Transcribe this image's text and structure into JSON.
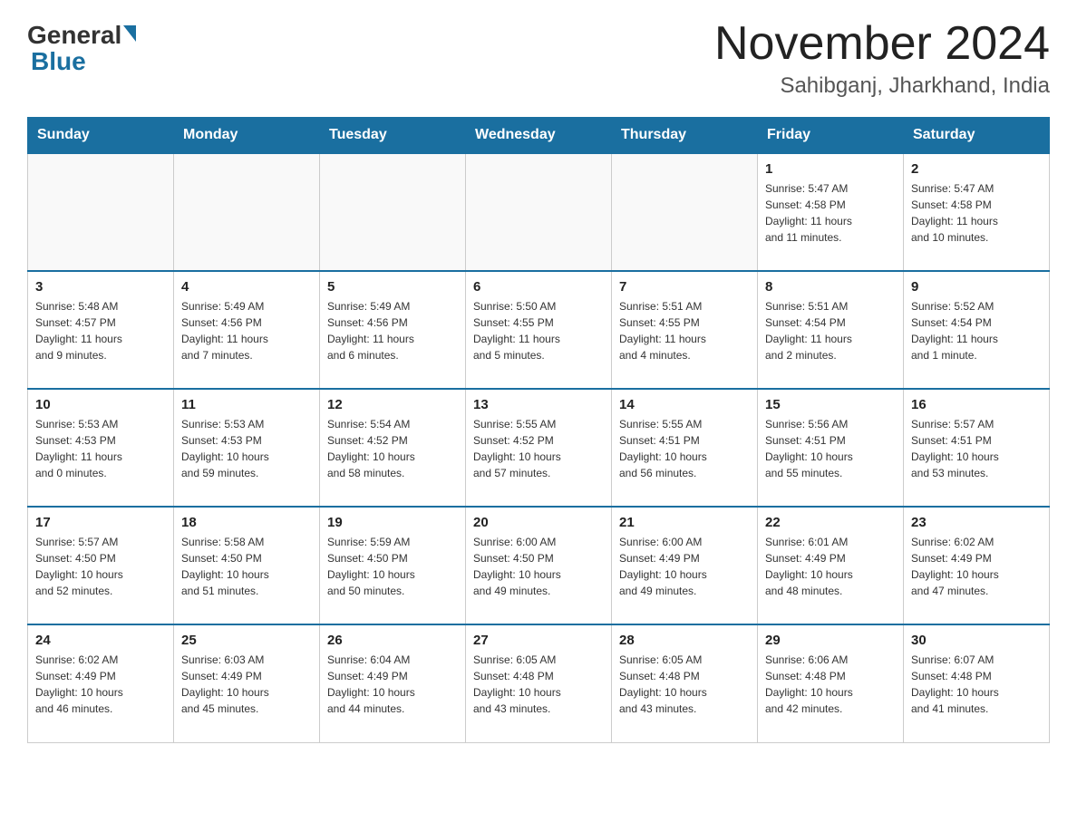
{
  "header": {
    "logo_general": "General",
    "logo_blue": "Blue",
    "month_title": "November 2024",
    "subtitle": "Sahibganj, Jharkhand, India"
  },
  "days_of_week": [
    "Sunday",
    "Monday",
    "Tuesday",
    "Wednesday",
    "Thursday",
    "Friday",
    "Saturday"
  ],
  "weeks": [
    [
      {
        "day": "",
        "info": ""
      },
      {
        "day": "",
        "info": ""
      },
      {
        "day": "",
        "info": ""
      },
      {
        "day": "",
        "info": ""
      },
      {
        "day": "",
        "info": ""
      },
      {
        "day": "1",
        "info": "Sunrise: 5:47 AM\nSunset: 4:58 PM\nDaylight: 11 hours\nand 11 minutes."
      },
      {
        "day": "2",
        "info": "Sunrise: 5:47 AM\nSunset: 4:58 PM\nDaylight: 11 hours\nand 10 minutes."
      }
    ],
    [
      {
        "day": "3",
        "info": "Sunrise: 5:48 AM\nSunset: 4:57 PM\nDaylight: 11 hours\nand 9 minutes."
      },
      {
        "day": "4",
        "info": "Sunrise: 5:49 AM\nSunset: 4:56 PM\nDaylight: 11 hours\nand 7 minutes."
      },
      {
        "day": "5",
        "info": "Sunrise: 5:49 AM\nSunset: 4:56 PM\nDaylight: 11 hours\nand 6 minutes."
      },
      {
        "day": "6",
        "info": "Sunrise: 5:50 AM\nSunset: 4:55 PM\nDaylight: 11 hours\nand 5 minutes."
      },
      {
        "day": "7",
        "info": "Sunrise: 5:51 AM\nSunset: 4:55 PM\nDaylight: 11 hours\nand 4 minutes."
      },
      {
        "day": "8",
        "info": "Sunrise: 5:51 AM\nSunset: 4:54 PM\nDaylight: 11 hours\nand 2 minutes."
      },
      {
        "day": "9",
        "info": "Sunrise: 5:52 AM\nSunset: 4:54 PM\nDaylight: 11 hours\nand 1 minute."
      }
    ],
    [
      {
        "day": "10",
        "info": "Sunrise: 5:53 AM\nSunset: 4:53 PM\nDaylight: 11 hours\nand 0 minutes."
      },
      {
        "day": "11",
        "info": "Sunrise: 5:53 AM\nSunset: 4:53 PM\nDaylight: 10 hours\nand 59 minutes."
      },
      {
        "day": "12",
        "info": "Sunrise: 5:54 AM\nSunset: 4:52 PM\nDaylight: 10 hours\nand 58 minutes."
      },
      {
        "day": "13",
        "info": "Sunrise: 5:55 AM\nSunset: 4:52 PM\nDaylight: 10 hours\nand 57 minutes."
      },
      {
        "day": "14",
        "info": "Sunrise: 5:55 AM\nSunset: 4:51 PM\nDaylight: 10 hours\nand 56 minutes."
      },
      {
        "day": "15",
        "info": "Sunrise: 5:56 AM\nSunset: 4:51 PM\nDaylight: 10 hours\nand 55 minutes."
      },
      {
        "day": "16",
        "info": "Sunrise: 5:57 AM\nSunset: 4:51 PM\nDaylight: 10 hours\nand 53 minutes."
      }
    ],
    [
      {
        "day": "17",
        "info": "Sunrise: 5:57 AM\nSunset: 4:50 PM\nDaylight: 10 hours\nand 52 minutes."
      },
      {
        "day": "18",
        "info": "Sunrise: 5:58 AM\nSunset: 4:50 PM\nDaylight: 10 hours\nand 51 minutes."
      },
      {
        "day": "19",
        "info": "Sunrise: 5:59 AM\nSunset: 4:50 PM\nDaylight: 10 hours\nand 50 minutes."
      },
      {
        "day": "20",
        "info": "Sunrise: 6:00 AM\nSunset: 4:50 PM\nDaylight: 10 hours\nand 49 minutes."
      },
      {
        "day": "21",
        "info": "Sunrise: 6:00 AM\nSunset: 4:49 PM\nDaylight: 10 hours\nand 49 minutes."
      },
      {
        "day": "22",
        "info": "Sunrise: 6:01 AM\nSunset: 4:49 PM\nDaylight: 10 hours\nand 48 minutes."
      },
      {
        "day": "23",
        "info": "Sunrise: 6:02 AM\nSunset: 4:49 PM\nDaylight: 10 hours\nand 47 minutes."
      }
    ],
    [
      {
        "day": "24",
        "info": "Sunrise: 6:02 AM\nSunset: 4:49 PM\nDaylight: 10 hours\nand 46 minutes."
      },
      {
        "day": "25",
        "info": "Sunrise: 6:03 AM\nSunset: 4:49 PM\nDaylight: 10 hours\nand 45 minutes."
      },
      {
        "day": "26",
        "info": "Sunrise: 6:04 AM\nSunset: 4:49 PM\nDaylight: 10 hours\nand 44 minutes."
      },
      {
        "day": "27",
        "info": "Sunrise: 6:05 AM\nSunset: 4:48 PM\nDaylight: 10 hours\nand 43 minutes."
      },
      {
        "day": "28",
        "info": "Sunrise: 6:05 AM\nSunset: 4:48 PM\nDaylight: 10 hours\nand 43 minutes."
      },
      {
        "day": "29",
        "info": "Sunrise: 6:06 AM\nSunset: 4:48 PM\nDaylight: 10 hours\nand 42 minutes."
      },
      {
        "day": "30",
        "info": "Sunrise: 6:07 AM\nSunset: 4:48 PM\nDaylight: 10 hours\nand 41 minutes."
      }
    ]
  ]
}
